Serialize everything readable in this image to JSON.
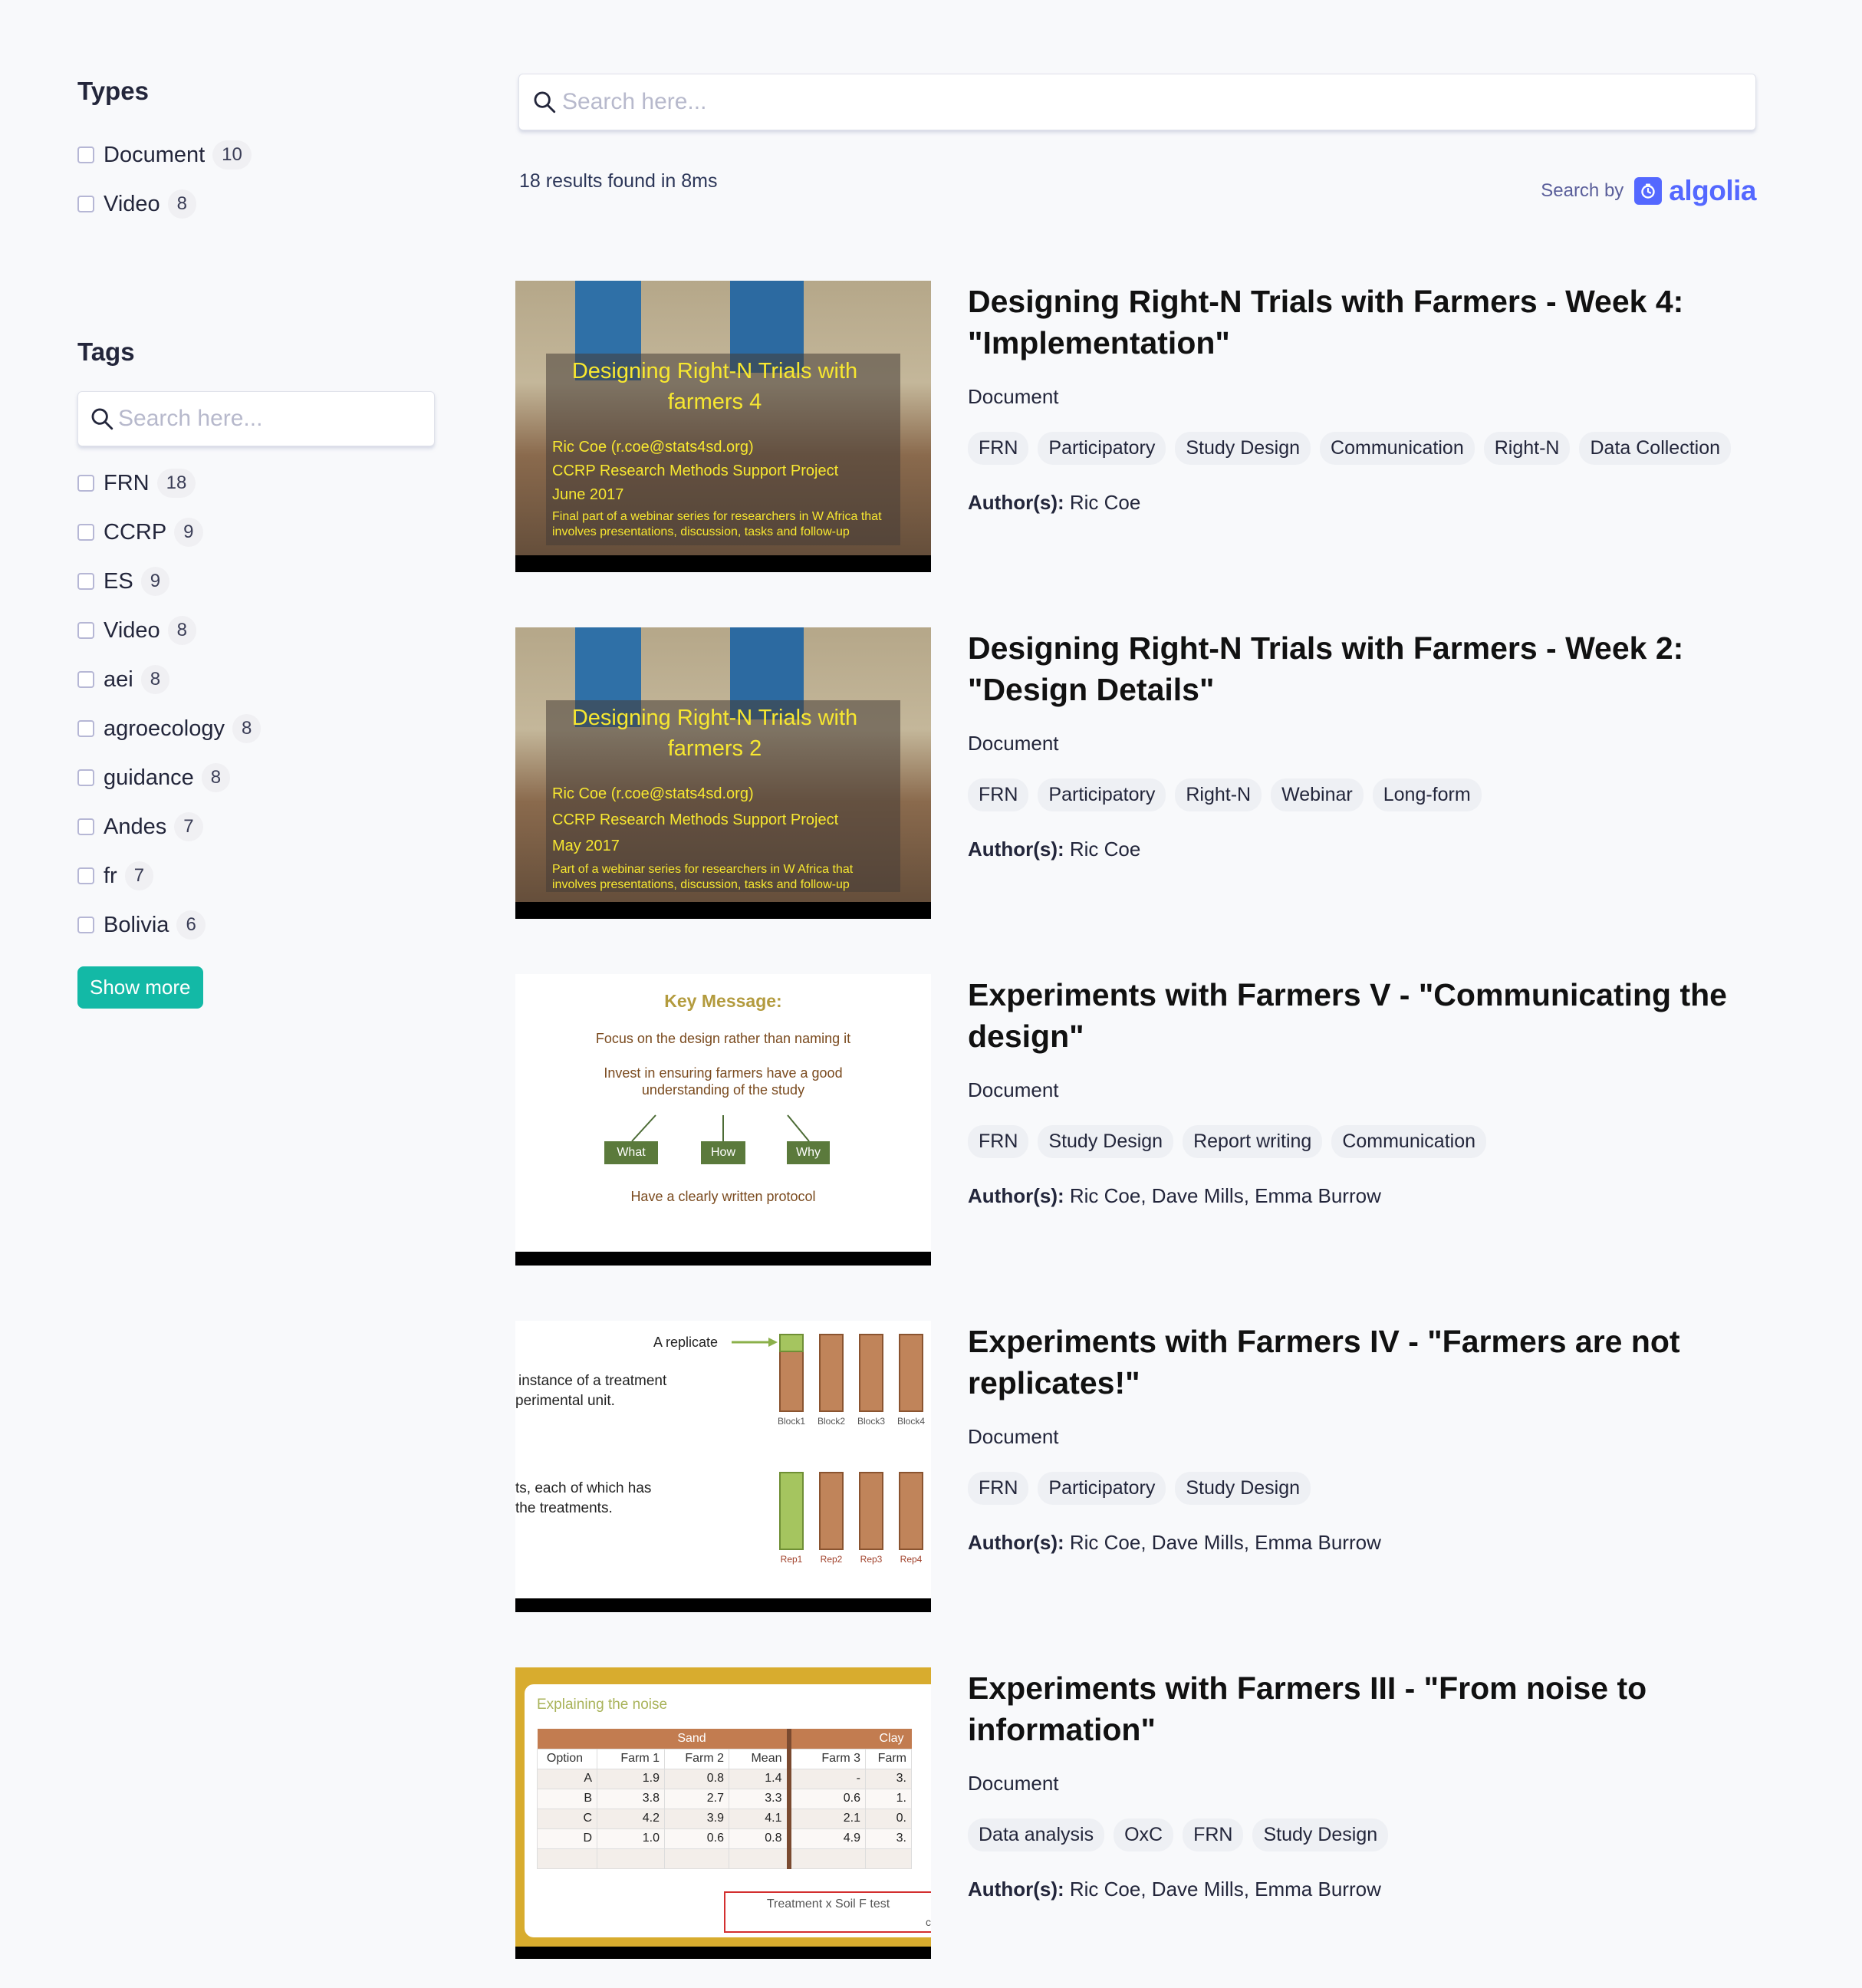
{
  "sidebar": {
    "types": {
      "title": "Types",
      "items": [
        {
          "label": "Document",
          "count": "10"
        },
        {
          "label": "Video",
          "count": "8"
        }
      ]
    },
    "tags": {
      "title": "Tags",
      "search_placeholder": "Search here...",
      "items": [
        {
          "label": "FRN",
          "count": "18"
        },
        {
          "label": "CCRP",
          "count": "9"
        },
        {
          "label": "ES",
          "count": "9"
        },
        {
          "label": "Video",
          "count": "8"
        },
        {
          "label": "aei",
          "count": "8"
        },
        {
          "label": "agroecology",
          "count": "8"
        },
        {
          "label": "guidance",
          "count": "8"
        },
        {
          "label": "Andes",
          "count": "7"
        },
        {
          "label": "fr",
          "count": "7"
        },
        {
          "label": "Bolivia",
          "count": "6"
        }
      ],
      "show_more_label": "Show more"
    }
  },
  "search": {
    "placeholder": "Search here...",
    "stats": "18 results found in 8ms",
    "powered_by_label": "Search by",
    "powered_by_brand": "algolia"
  },
  "hits": [
    {
      "title": "Designing Right-N Trials with Farmers - Week 4: \"Implementation\"",
      "type": "Document",
      "tags": [
        "FRN",
        "Participatory",
        "Study Design",
        "Communication",
        "Right-N",
        "Data Collection"
      ],
      "authors_label": "Author(s):",
      "authors": "Ric Coe",
      "thumb": {
        "kind": "photo",
        "title": "Designing Right-N Trials with farmers 4",
        "lines": [
          "Ric Coe (r.coe@stats4sd.org)",
          "CCRP Research Methods Support Project",
          "June 2017"
        ],
        "small": "Final part of a webinar series for researchers in W Africa that involves presentations, discussion, tasks and follow-up"
      }
    },
    {
      "title": "Designing Right-N Trials with Farmers - Week 2: \"Design Details\"",
      "type": "Document",
      "tags": [
        "FRN",
        "Participatory",
        "Right-N",
        "Webinar",
        "Long-form"
      ],
      "authors_label": "Author(s):",
      "authors": "Ric Coe",
      "thumb": {
        "kind": "photo",
        "title": "Designing Right-N Trials with farmers 2",
        "lines": [
          "Ric Coe (r.coe@stats4sd.org)",
          "CCRP Research Methods Support Project",
          "May 2017"
        ],
        "small": "Part of a webinar series for researchers in W Africa that involves presentations, discussion, tasks and follow-up"
      }
    },
    {
      "title": "Experiments with Farmers V - \"Communicating the design\"",
      "type": "Document",
      "tags": [
        "FRN",
        "Study Design",
        "Report writing",
        "Communication"
      ],
      "authors_label": "Author(s):",
      "authors": "Ric Coe, Dave Mills, Emma Burrow",
      "thumb": {
        "kind": "keymsg",
        "heading": "Key Message:",
        "l1": "Focus on the design rather than naming it",
        "l2": "Invest in ensuring farmers have a good understanding of the study",
        "boxes": [
          "What",
          "How",
          "Why"
        ],
        "l3": "Have a clearly written protocol"
      }
    },
    {
      "title": "Experiments with Farmers IV - \"Farmers are not replicates!\"",
      "type": "Document",
      "tags": [
        "FRN",
        "Participatory",
        "Study Design"
      ],
      "authors_label": "Author(s):",
      "authors": "Ric Coe, Dave Mills, Emma Burrow",
      "thumb": {
        "kind": "blocks",
        "label": "A replicate",
        "t1": "instance of a treatment",
        "t2": "perimental unit.",
        "t3": "ts, each of which has",
        "t4": "the treatments.",
        "blocks": [
          "Block1",
          "Block2",
          "Block3",
          "Block4"
        ],
        "reps": [
          "Rep1",
          "Rep2",
          "Rep3",
          "Rep4"
        ]
      }
    },
    {
      "title": "Experiments with Farmers III - \"From noise to information\"",
      "type": "Document",
      "tags": [
        "Data analysis",
        "OxC",
        "FRN",
        "Study Design"
      ],
      "authors_label": "Author(s):",
      "authors": "Ric Coe, Dave Mills, Emma Burrow",
      "thumb": {
        "kind": "table",
        "heading": "Explaining the noise",
        "group1": "Sand",
        "group2": "Clay",
        "headers": [
          "Option",
          "Farm 1",
          "Farm 2",
          "Mean",
          "Farm 3",
          "Farm"
        ],
        "rows": [
          [
            "A",
            "1.9",
            "0.8",
            "1.4",
            "-",
            "3."
          ],
          [
            "B",
            "3.8",
            "2.7",
            "3.3",
            "0.6",
            "1."
          ],
          [
            "C",
            "4.2",
            "3.9",
            "4.1",
            "2.1",
            "0."
          ],
          [
            "D",
            "1.0",
            "0.6",
            "0.8",
            "4.9",
            "3."
          ]
        ],
        "note": "Treatment x Soil F test",
        "note_tail": "c"
      }
    }
  ],
  "colors": {
    "accent": "#13b9a6",
    "algolia": "#5468ff",
    "background": "#f8f9fb"
  }
}
